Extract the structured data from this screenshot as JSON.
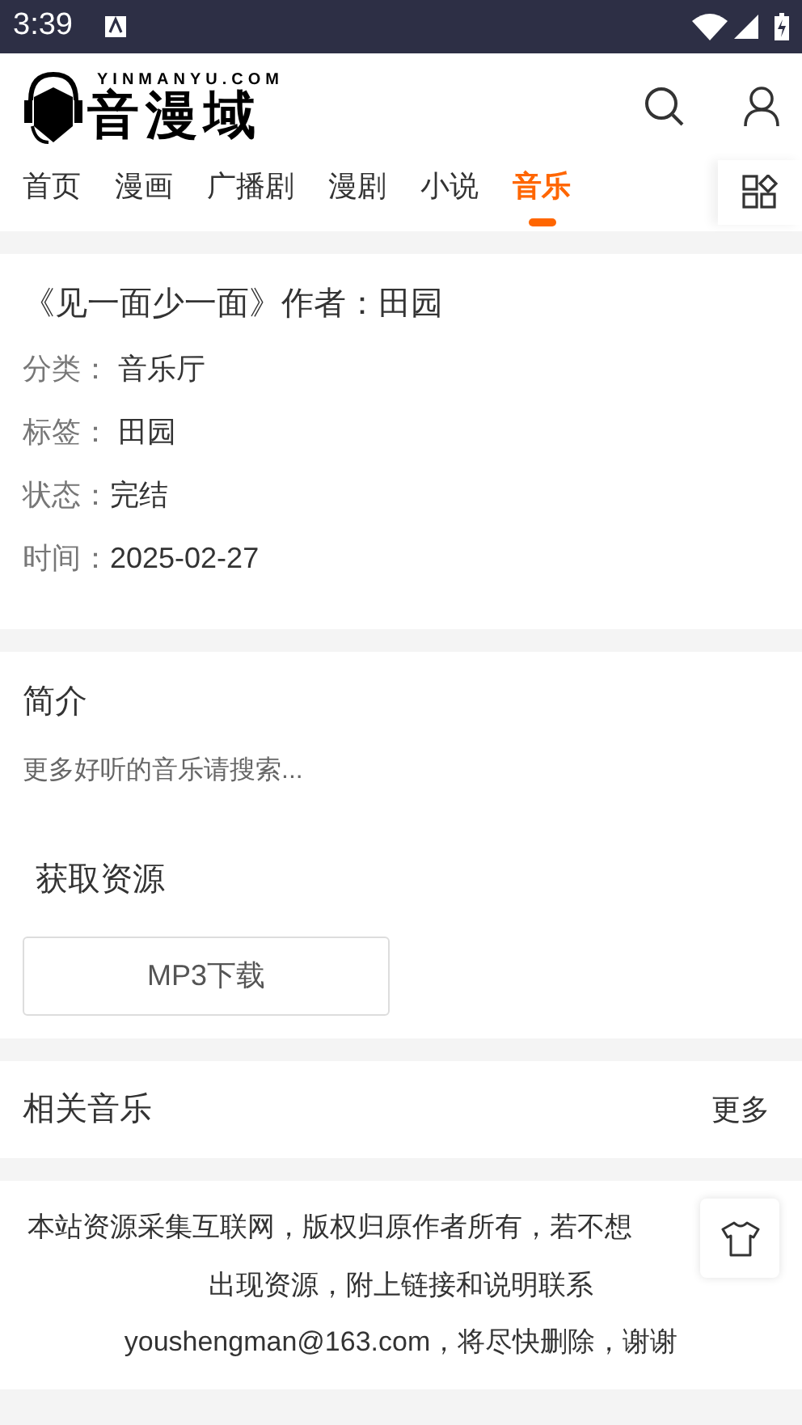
{
  "status_bar": {
    "time": "3:39"
  },
  "header": {
    "logo_domain": "YINMANYU.COM",
    "logo_name": "音漫域"
  },
  "tabs": [
    {
      "label": "首页",
      "selected": false
    },
    {
      "label": "漫画",
      "selected": false
    },
    {
      "label": "广播剧",
      "selected": false
    },
    {
      "label": "漫剧",
      "selected": false
    },
    {
      "label": "小说",
      "selected": false
    },
    {
      "label": "音乐",
      "selected": true
    }
  ],
  "detail": {
    "title": "《见一面少一面》作者：田园",
    "fields": [
      {
        "label": "分类：",
        "value": " 音乐厅"
      },
      {
        "label": "标签：",
        "value": " 田园"
      },
      {
        "label": "状态：",
        "value": "完结"
      },
      {
        "label": "时间：",
        "value": "2025-02-27"
      }
    ]
  },
  "intro": {
    "heading": "简介",
    "text": "更多好听的音乐请搜索...",
    "resource_heading": "获取资源",
    "download_button": "MP3下载"
  },
  "related": {
    "heading": "相关音乐",
    "more": "更多"
  },
  "footer": {
    "lines": [
      "本站资源采集互联网，版权归原作者所有，若不想",
      "出现资源，附上链接和说明联系",
      "youshengman@163.com，将尽快删除，谢谢"
    ]
  }
}
